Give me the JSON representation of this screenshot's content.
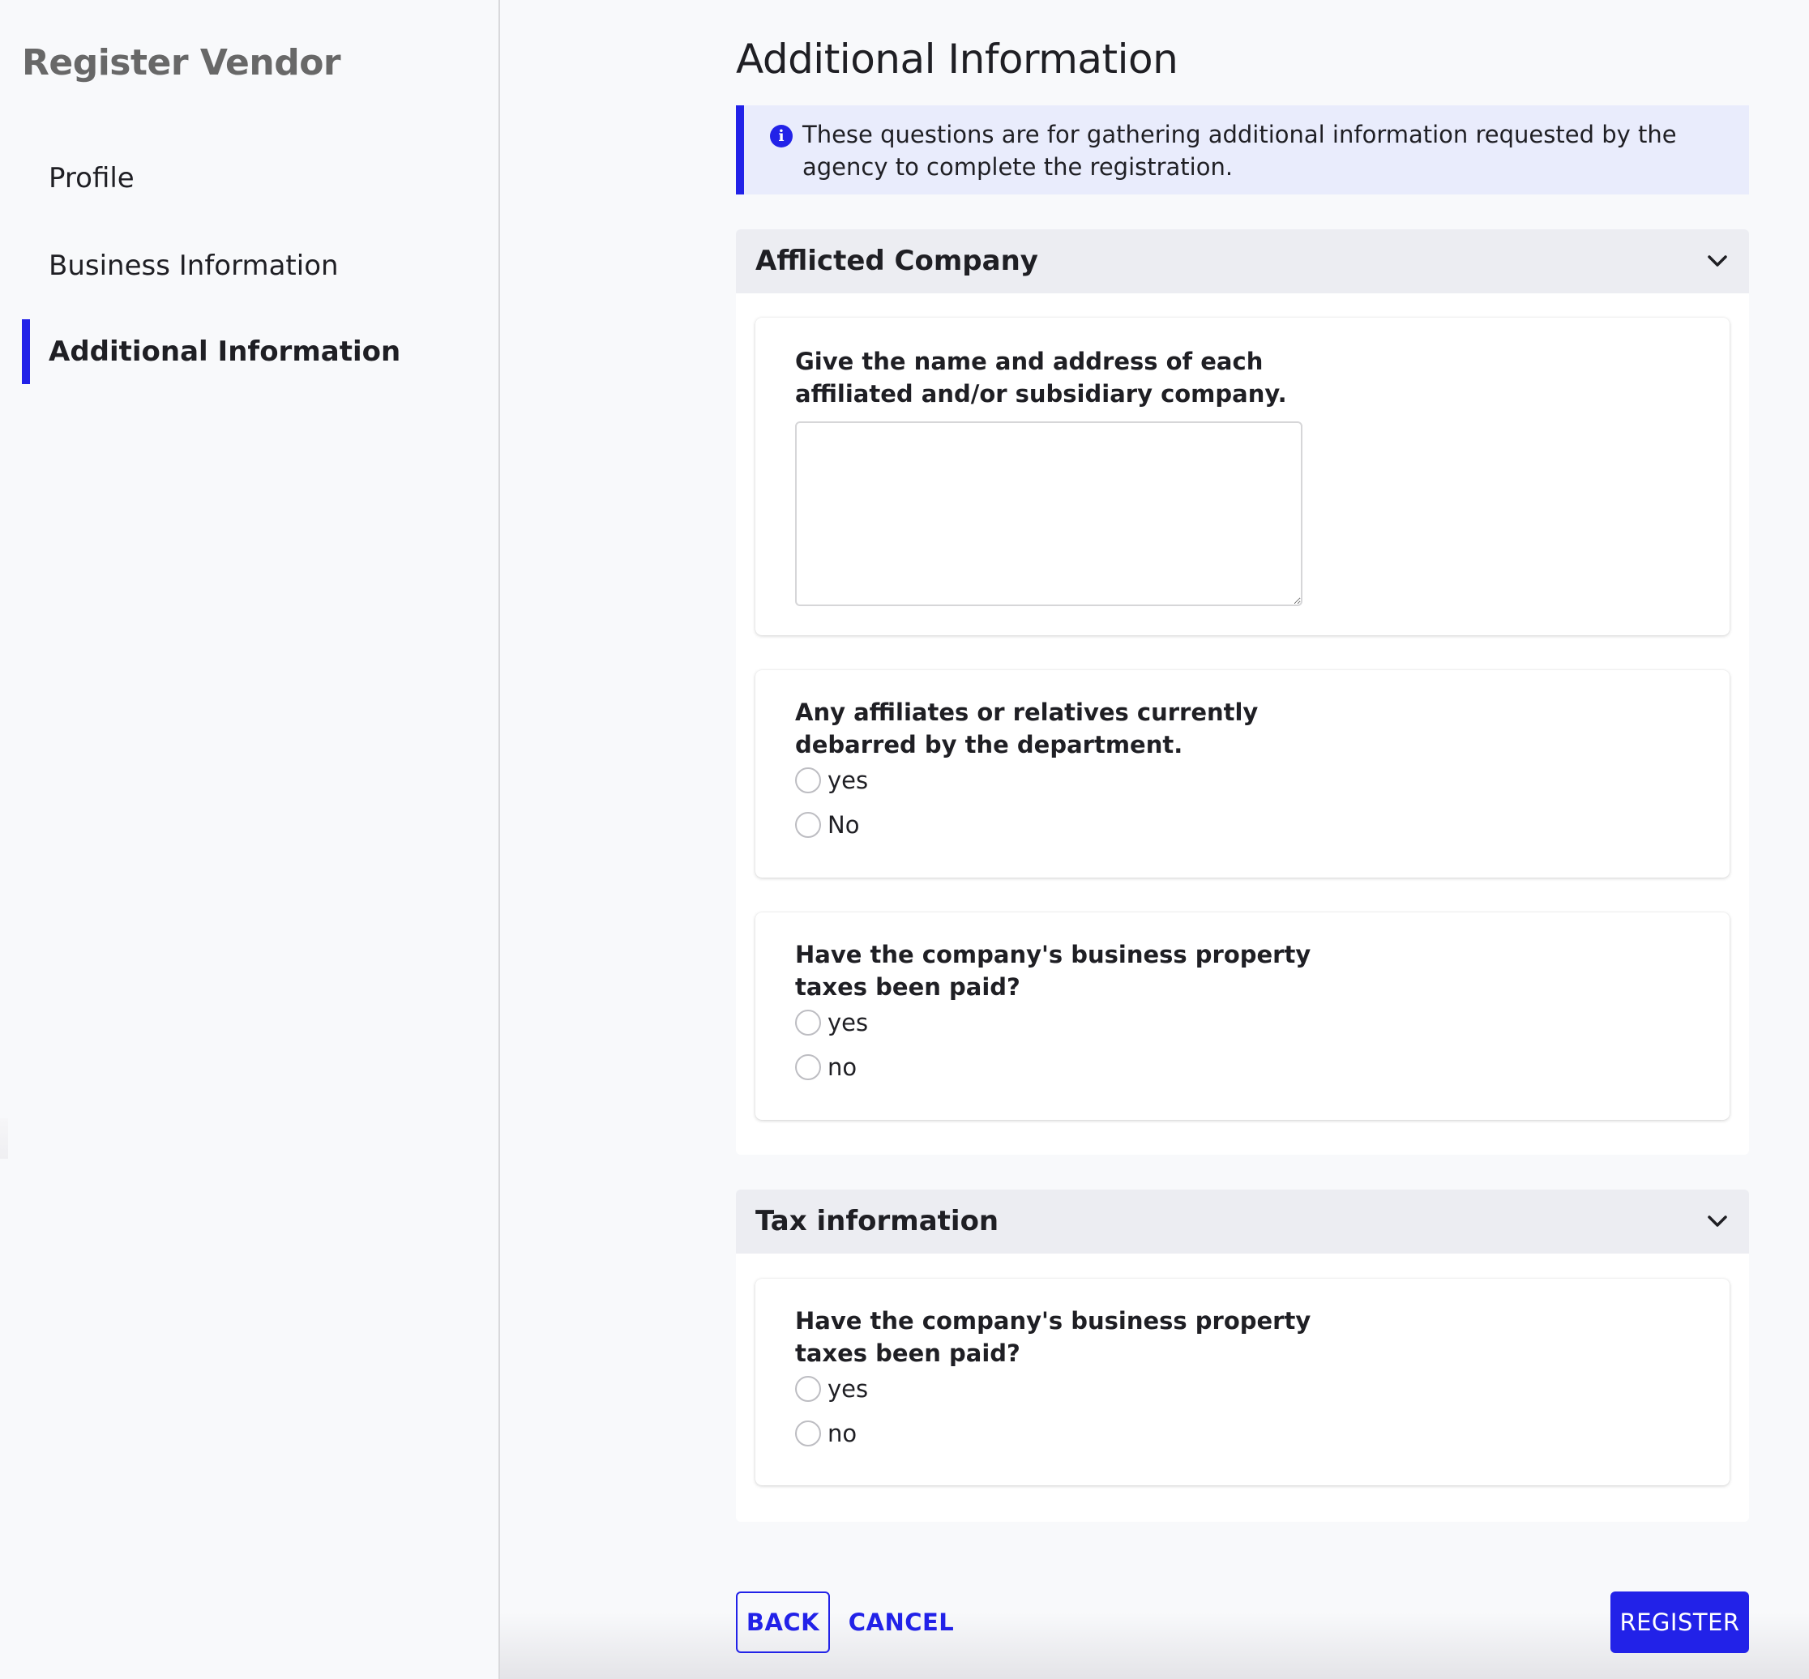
{
  "sidebar": {
    "title": "Register Vendor",
    "items": [
      {
        "label": "Profile",
        "active": false
      },
      {
        "label": "Business Information",
        "active": false
      },
      {
        "label": "Additional Information",
        "active": true
      }
    ]
  },
  "main": {
    "title": "Additional Information",
    "banner": {
      "icon": "info-icon",
      "icon_glyph": "i",
      "text": "These questions are for gathering additional information requested by the agency to complete the registration."
    },
    "sections": [
      {
        "title": "Afflicted Company",
        "expanded": true,
        "questions": [
          {
            "label": "Give the name and address of each affiliated and/or subsidiary company.",
            "type": "textarea",
            "value": "",
            "placeholder": ""
          },
          {
            "label": "Any affiliates or relatives currently debarred by the department.",
            "type": "radio",
            "options": [
              "yes",
              "No"
            ],
            "selected": null
          },
          {
            "label": "Have the company's business property taxes been paid?",
            "type": "radio",
            "options": [
              "yes",
              "no"
            ],
            "selected": null
          }
        ]
      },
      {
        "title": "Tax information",
        "expanded": true,
        "questions": [
          {
            "label": "Have the company's business property taxes been paid?",
            "type": "radio",
            "options": [
              "yes",
              "no"
            ],
            "selected": null
          }
        ]
      }
    ]
  },
  "footer": {
    "back_label": "BACK",
    "cancel_label": "CANCEL",
    "register_label": "REGISTER"
  },
  "colors": {
    "accent": "#2222e8",
    "banner_bg": "#e9ecfc",
    "accordion_header_bg": "#ecedf2",
    "page_bg": "#f8f9fb"
  }
}
